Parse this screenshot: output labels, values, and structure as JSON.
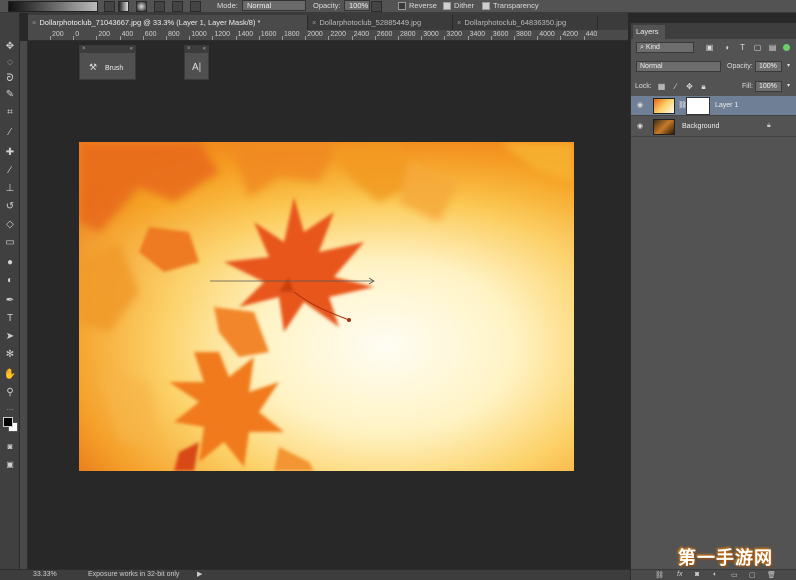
{
  "options_bar": {
    "mode_label": "Mode:",
    "mode_value": "Normal",
    "opacity_label": "Opacity:",
    "opacity_value": "100%",
    "reverse_label": "Reverse",
    "dither_label": "Dither",
    "transparency_label": "Transparency"
  },
  "tabs": [
    {
      "label": "Dollarphotoclub_71043667.jpg @ 33.3% (Layer 1, Layer Mask/8) *",
      "active": true
    },
    {
      "label": "Dollarphotoclub_52885449.jpg",
      "active": false
    },
    {
      "label": "Dollarphotoclub_64836350.jpg",
      "active": false
    }
  ],
  "ruler_ticks": [
    "200",
    "0",
    "200",
    "400",
    "600",
    "800",
    "1000",
    "1200",
    "1400",
    "1600",
    "1800",
    "2000",
    "2200",
    "2400",
    "2600",
    "2800",
    "3000",
    "3200",
    "3400",
    "3600",
    "3800",
    "4000",
    "4200",
    "440"
  ],
  "floating_panels": {
    "brush_label": "Brush",
    "char_label": "A|"
  },
  "status_bar": {
    "zoom": "33.33%",
    "message": "Exposure works in 32-bit only"
  },
  "layers_panel": {
    "tab_label": "Layers",
    "filter_value": "Kind",
    "blend_mode": "Normal",
    "opacity_label": "Opacity:",
    "opacity_value": "100%",
    "lock_label": "Lock:",
    "fill_label": "Fill:",
    "fill_value": "100%",
    "layers": [
      {
        "name": "Layer 1",
        "selected": true
      },
      {
        "name": "Background",
        "selected": false
      }
    ]
  },
  "watermark": "第一手游网",
  "colors": {
    "ui_dark": "#282828",
    "panel": "#535353",
    "selection": "#6f7f95",
    "leaf_orange": "#e8631a",
    "leaf_yellow": "#f9b421"
  },
  "icons": [
    "move-icon",
    "marquee-icon",
    "lasso-icon",
    "quick-select-icon",
    "crop-icon",
    "eyedropper-icon",
    "healing-icon",
    "brush-icon",
    "stamp-icon",
    "history-brush-icon",
    "eraser-icon",
    "gradient-icon",
    "blur-icon",
    "dodge-icon",
    "pen-icon",
    "type-icon",
    "path-select-icon",
    "shape-icon",
    "hand-icon",
    "zoom-icon"
  ]
}
